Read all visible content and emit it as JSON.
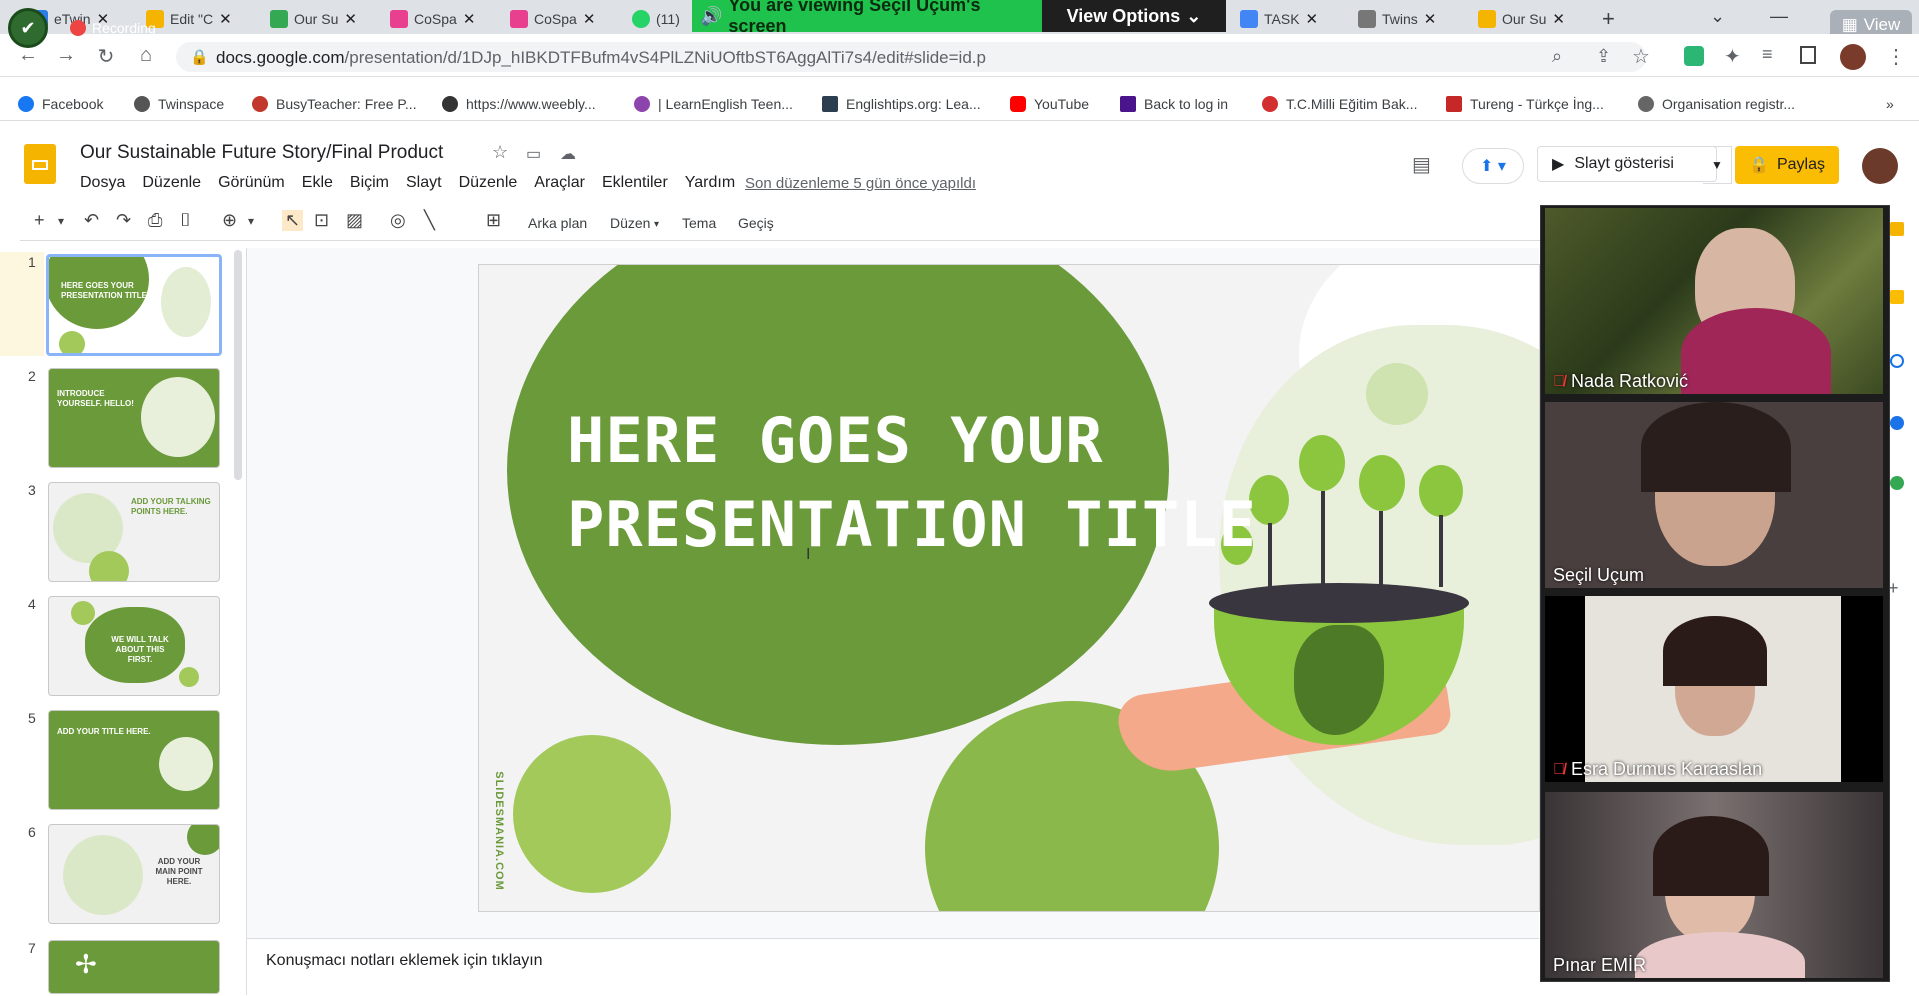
{
  "browser": {
    "tabs": [
      {
        "label": "eTwin",
        "color": "#2b7de9"
      },
      {
        "label": "Edit \"C",
        "color": "#f4b400"
      },
      {
        "label": "Our Su",
        "color": "#34a853"
      },
      {
        "label": "CoSpa",
        "color": "#e8408f"
      },
      {
        "label": "CoSpa",
        "color": "#e8408f"
      },
      {
        "label": "(11)",
        "color": "#25d366"
      },
      {
        "label": "TASK",
        "color": "#4285f4"
      },
      {
        "label": "Twins",
        "color": "#777777"
      },
      {
        "label": "Our Su",
        "color": "#f4b400"
      }
    ],
    "new_tab": "+",
    "url_host": "docs.google.com",
    "url_path": "/presentation/d/1DJp_hIBKDTFBufm4vS4PlLZNiUOftbST6AggAlTi7s4/edit#slide=id.p",
    "recording_label": "Recording",
    "view_label": "View"
  },
  "screenshare": {
    "banner": "You are viewing Seçil Uçum's screen",
    "view_options": "View Options"
  },
  "bookmarks": [
    {
      "label": "Facebook",
      "color": "#1877f2"
    },
    {
      "label": "Twinspace",
      "color": "#555555"
    },
    {
      "label": "BusyTeacher: Free P...",
      "color": "#c0392b"
    },
    {
      "label": "https://www.weebly...",
      "color": "#333333"
    },
    {
      "label": "| LearnEnglish Teen...",
      "color": "#8e44ad"
    },
    {
      "label": "Englishtips.org: Lea...",
      "color": "#2c3e50"
    },
    {
      "label": "YouTube",
      "color": "#ff0000"
    },
    {
      "label": "Back to log in",
      "color": "#4a148c"
    },
    {
      "label": "T.C.Milli Eğitim Bak...",
      "color": "#d32f2f"
    },
    {
      "label": "Tureng - Türkçe İng...",
      "color": "#c62828"
    },
    {
      "label": "Organisation registr...",
      "color": "#666666"
    }
  ],
  "doc": {
    "title": "Our Sustainable Future Story/Final Product",
    "menu": [
      "Dosya",
      "Düzenle",
      "Görünüm",
      "Ekle",
      "Biçim",
      "Slayt",
      "Düzenle",
      "Araçlar",
      "Eklentiler",
      "Yardım"
    ],
    "last_edit": "Son düzenleme 5 gün önce yapıldı",
    "slideshow": "Slayt gösterisi",
    "share": "Paylaş",
    "toolbar": {
      "background": "Arka plan",
      "layout": "Düzen",
      "theme": "Tema",
      "transition": "Geçiş"
    },
    "notes_placeholder": "Konuşmacı notları eklemek için tıklayın"
  },
  "slides": [
    {
      "num": "1",
      "text": "HERE GOES YOUR PRESENTATION TITLE"
    },
    {
      "num": "2",
      "text": "INTRODUCE YOURSELF. HELLO!"
    },
    {
      "num": "3",
      "text": "ADD YOUR TALKING POINTS HERE."
    },
    {
      "num": "4",
      "text": "WE WILL TALK ABOUT THIS FIRST."
    },
    {
      "num": "5",
      "text": "ADD YOUR TITLE HERE."
    },
    {
      "num": "6",
      "text": "ADD YOUR MAIN POINT HERE."
    },
    {
      "num": "7",
      "text": ""
    }
  ],
  "slide_main": {
    "title_line1": "HERE GOES YOUR",
    "title_line2": "PRESENTATION TITLE",
    "credit": "SLIDESMANIA.COM",
    "colors": {
      "dark_green": "#6a9a3a",
      "light_green": "#a2c95a",
      "pale": "#e8f0dc"
    }
  },
  "participants": [
    {
      "name": "Nada Ratković",
      "muted": true
    },
    {
      "name": "Seçil Uçum",
      "muted": false
    },
    {
      "name": "Esra Durmus Karaaslan",
      "muted": true
    },
    {
      "name": "Pınar EMİR",
      "muted": false
    }
  ]
}
